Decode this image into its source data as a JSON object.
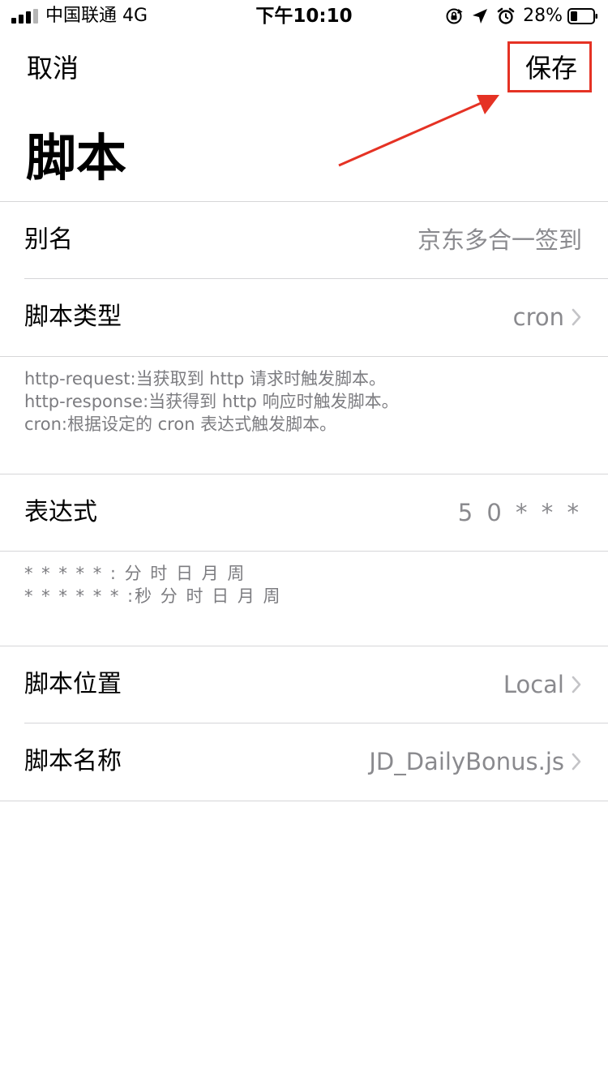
{
  "status_bar": {
    "carrier": "中国联通  4G",
    "time": "下午10:10",
    "battery_percent": "28%"
  },
  "nav": {
    "cancel_label": "取消",
    "save_label": "保存",
    "highlight_color": "#e53224"
  },
  "title": "脚本",
  "rows": {
    "alias": {
      "label": "别名",
      "value": "京东多合一签到"
    },
    "script_type": {
      "label": "脚本类型",
      "value": "cron"
    },
    "expression": {
      "label": "表达式",
      "value": "5 0 * * *"
    },
    "script_location": {
      "label": "脚本位置",
      "value": "Local"
    },
    "script_name": {
      "label": "脚本名称",
      "value": "JD_DailyBonus.js"
    }
  },
  "notes": {
    "type_help": [
      "http-request:当获取到 http 请求时触发脚本。",
      "http-response:当获得到 http 响应时触发脚本。",
      "cron:根据设定的 cron 表达式触发脚本。"
    ],
    "expression_help": [
      "* * * * * : 分 时 日 月 周",
      "* * * * * * :秒 分 时 日 月 周"
    ]
  },
  "icons": {
    "signal": "cellular-signal-icon",
    "rotation_lock": "rotation-lock-icon",
    "location": "location-arrow-icon",
    "alarm": "alarm-clock-icon",
    "battery": "battery-icon",
    "chevron": "chevron-right-icon"
  }
}
